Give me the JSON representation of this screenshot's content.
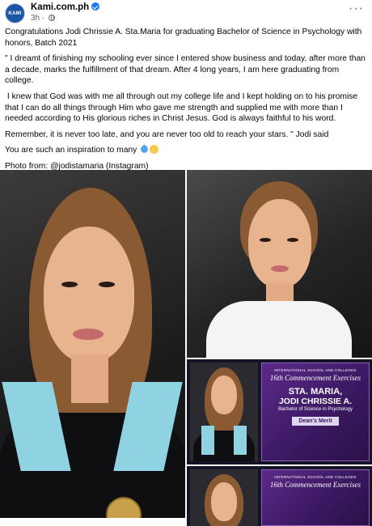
{
  "header": {
    "avatar_text": "KAMI",
    "page_name": "Kami.com.ph",
    "time": "3h",
    "dot": "·",
    "more": "···"
  },
  "post": {
    "paragraphs": [
      "Congratulations Jodi Chrissie A. Sta.Maria for graduating Bachelor of Science in Psychology with honors, Batch 2021",
      "\" I dreamt of finishing my schooling ever since I entered show business and today, after more than a decade, marks the fulfillment of that dream. After 4 long years, I am here graduating from college.",
      " I knew that God was with me all through out my college life and I kept holding on to his promise that I can do all things through Him who gave me strength and supplied me with more than I needed according to His glorious riches in Christ Jesus. God is always faithful to his word.",
      "Remember, it is never too late, and you are never too old to reach your stars. \" Jodi said",
      "You are such an inspiration to many",
      "Photo from: @jodistamaria (Instagram)"
    ]
  },
  "photos": {
    "panel1": {
      "school": "INTERNATIONAL SCHOOL AND COLLEGES",
      "exercise": "16th Commencement Exercises",
      "lastname": "STA. MARIA,",
      "fullname": "JODI CHRISSIE A.",
      "degree": "Bachelor of Science in Psychology",
      "honor": "Dean's Merit"
    },
    "panel2": {
      "school": "INTERNATIONAL SCHOOL AND COLLEGES",
      "exercise": "16th Commencement Exercises"
    }
  },
  "icons": [
    "verified-badge-icon",
    "globe-icon",
    "more-options-icon",
    "blue-heart-emoji",
    "smiling-emoji"
  ],
  "colors": {
    "verified": "#1877f2",
    "meta": "#65676b",
    "panel_purple": "#5b2a8a",
    "hood": "#8fd3e3"
  }
}
